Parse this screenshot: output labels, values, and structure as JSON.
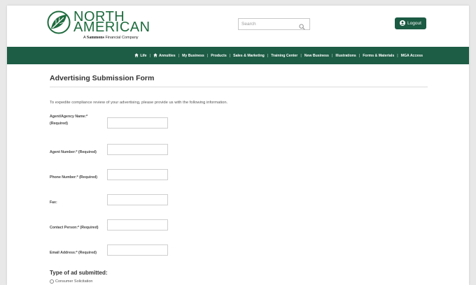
{
  "brand": {
    "line1": "NORTH",
    "line2": "AMERICAN",
    "tagline_prefix": "A",
    "tagline_brand": "Sammons",
    "tagline_suffix": "Financial Company",
    "green": "#1e6b3e"
  },
  "search": {
    "placeholder": "Search",
    "icon": "search-icon"
  },
  "logout": {
    "label": "Logout",
    "icon": "user-circle-icon"
  },
  "nav": {
    "color": "#1d5c45",
    "items": [
      {
        "label": "Life",
        "icon": "home-icon"
      },
      {
        "label": "Annuities",
        "icon": "home-icon"
      },
      {
        "label": "My Business"
      },
      {
        "label": "Products"
      },
      {
        "label": "Sales & Marketing"
      },
      {
        "label": "Training Center"
      },
      {
        "label": "New Business"
      },
      {
        "label": "Illustrations"
      },
      {
        "label": "Forms & Materials"
      },
      {
        "label": "MGA Access"
      }
    ]
  },
  "form": {
    "title": "Advertising Submission Form",
    "intro": "To expedite compliance review of your advertising, please provide us with the following information.",
    "fields": [
      {
        "label_line1": "Agent/Agency Name:*",
        "label_line2": "(Required)",
        "value": ""
      },
      {
        "label_line1": "Agent Number:* (Required)",
        "value": ""
      },
      {
        "label_line1": "Phone Number:* (Required)",
        "value": ""
      },
      {
        "label_line1": "Fax:",
        "value": ""
      },
      {
        "label_line1": "Contact Person:* (Required)",
        "value": ""
      },
      {
        "label_line1": "Email Address:* (Required)",
        "value": ""
      }
    ],
    "ad_type": {
      "title": "Type of ad submitted:",
      "options": [
        {
          "label": "Consumer Solicitation"
        }
      ]
    }
  }
}
